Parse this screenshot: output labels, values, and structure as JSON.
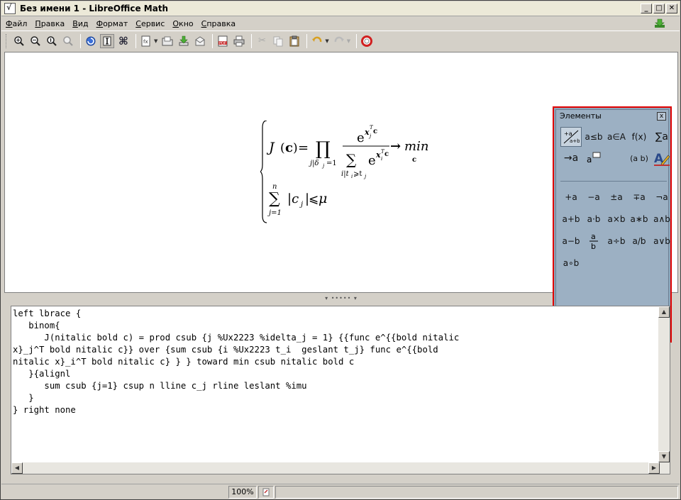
{
  "window": {
    "title": "Без имени 1 - LibreOffice Math",
    "minimize": "_",
    "maximize": "□",
    "close": "✕"
  },
  "menu": [
    "Файл",
    "Правка",
    "Вид",
    "Формат",
    "Сервис",
    "Окно",
    "Справка"
  ],
  "toolbar": {
    "icons": [
      "zoom-in-icon",
      "zoom-out-icon",
      "zoom-100-icon",
      "show-all-icon",
      "update-icon",
      "formula-cursor-icon",
      "symbols-icon",
      "import-formula-icon",
      "open-icon",
      "save-icon",
      "mail-icon",
      "export-pdf-icon",
      "print-icon",
      "cut-icon",
      "copy-icon",
      "paste-icon",
      "undo-icon",
      "redo-icon",
      "help-icon"
    ]
  },
  "elements_panel": {
    "title": "Элементы",
    "close": "x",
    "categories": [
      "+a a+b",
      "a≤b",
      "a∈A",
      "f(x)",
      "∑a",
      "→a",
      "a💬",
      "",
      "(a b)",
      "A"
    ],
    "symbols": [
      "+a",
      "−a",
      "±a",
      "∓a",
      "¬a",
      "a+b",
      "a·b",
      "a×b",
      "a∗b",
      "a∧b",
      "a−b",
      "a/b",
      "a÷b",
      "a/b",
      "a∨b",
      "a∘b"
    ]
  },
  "formula": {
    "lhs": "J",
    "lhs_arg": "c",
    "eq": "=",
    "prod": "∏",
    "prod_sub": "j|δj=1",
    "num": "e",
    "num_sup": "xjT c",
    "den_sum": "∑",
    "den_sum_sub": "i|ti⩾tj",
    "den_e": "e",
    "den_sup": "xiT c",
    "arrow": "→",
    "min": "min",
    "min_sub": "c",
    "sum": "∑",
    "sum_top": "n",
    "sum_bot": "j=1",
    "abs": "|c",
    "abs_sub": "j",
    "abs_close": "|",
    "leq": "⩽",
    "mu": "μ"
  },
  "command_text": "left lbrace {\n   binom{\n      J(nitalic bold c) = prod csub {j %Ux2223 %idelta_j = 1} {{func e^{{bold nitalic\nx}_j^T bold nitalic c}} over {sum csub {i %Ux2223 t_i  geslant t_j} func e^{{bold\nnitalic x}_i^T bold nitalic c} } } toward min csub nitalic bold c\n   }{alignl\n      sum csub {j=1} csup n lline c_j rline leslant %imu\n   }\n} right none",
  "statusbar": {
    "zoom": "100%"
  }
}
